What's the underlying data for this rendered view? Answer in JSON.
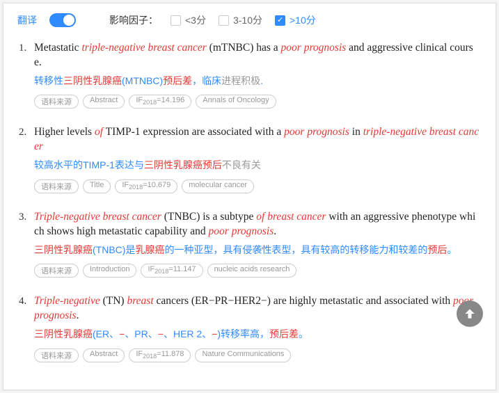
{
  "header": {
    "translate_label": "翻译",
    "factor_label": "影响因子：",
    "filters": [
      {
        "label": "<3分",
        "checked": false
      },
      {
        "label": "3-10分",
        "checked": false
      },
      {
        "label": ">10分",
        "checked": true
      }
    ]
  },
  "results": [
    {
      "num": "1.",
      "en_parts": [
        {
          "t": "Metastatic ",
          "h": false
        },
        {
          "t": "triple-negative breast cancer",
          "h": true
        },
        {
          "t": " (mTNBC) has a ",
          "h": false
        },
        {
          "t": "poor prognosis",
          "h": true
        },
        {
          "t": " and aggressive clinical course.",
          "h": false
        }
      ],
      "zh_parts": [
        {
          "t": "转移性",
          "c": "blue"
        },
        {
          "t": "三阴性乳腺癌",
          "c": "red"
        },
        {
          "t": "(MTNBC)",
          "c": "blue"
        },
        {
          "t": "预后差",
          "c": "red"
        },
        {
          "t": "，临床",
          "c": "blue"
        },
        {
          "t": "进程积极",
          "c": "gray"
        },
        {
          "t": ".",
          "c": "blue"
        }
      ],
      "tags": {
        "source": "语料来源",
        "section": "Abstract",
        "if_year": "2018",
        "if_val": "14.196",
        "journal": "Annals of Oncology"
      }
    },
    {
      "num": "2.",
      "en_parts": [
        {
          "t": "Higher levels ",
          "h": false
        },
        {
          "t": "of",
          "h": true
        },
        {
          "t": " TIMP-1 expression are associated with a ",
          "h": false
        },
        {
          "t": "poor prognosis",
          "h": true
        },
        {
          "t": " in ",
          "h": false
        },
        {
          "t": "triple-negative breast cancer",
          "h": true
        }
      ],
      "zh_parts": [
        {
          "t": "较高水平的TIMP-1表达与",
          "c": "blue"
        },
        {
          "t": "三阴性乳腺癌预后",
          "c": "red"
        },
        {
          "t": "不良有关",
          "c": "gray"
        }
      ],
      "tags": {
        "source": "语料来源",
        "section": "Title",
        "if_year": "2018",
        "if_val": "10.679",
        "journal": "molecular cancer"
      }
    },
    {
      "num": "3.",
      "en_parts": [
        {
          "t": "Triple-negative breast cancer",
          "h": true
        },
        {
          "t": " (TNBC) is a subtype ",
          "h": false
        },
        {
          "t": "of breast cancer",
          "h": true
        },
        {
          "t": " with an aggressive phenotype which shows high metastatic capability and ",
          "h": false
        },
        {
          "t": "poor prognosis",
          "h": true
        },
        {
          "t": ".",
          "h": false
        }
      ],
      "zh_parts": [
        {
          "t": "三阴性乳腺癌",
          "c": "red"
        },
        {
          "t": "(TNBC)是",
          "c": "blue"
        },
        {
          "t": "乳腺癌",
          "c": "red"
        },
        {
          "t": "的一种亚型，具有侵袭性表型，具有较高的转移能力和较差的",
          "c": "blue"
        },
        {
          "t": "预后",
          "c": "red"
        },
        {
          "t": "。",
          "c": "blue"
        }
      ],
      "tags": {
        "source": "语料来源",
        "section": "Introduction",
        "if_year": "2018",
        "if_val": "11.147",
        "journal": "nucleic acids research"
      }
    },
    {
      "num": "4.",
      "en_parts": [
        {
          "t": "Triple-negative",
          "h": true
        },
        {
          "t": " (TN) ",
          "h": false
        },
        {
          "t": "breast",
          "h": true
        },
        {
          "t": " cancers (ER−PR−HER2−) are highly metastatic and associated with ",
          "h": false
        },
        {
          "t": "poor prognosis",
          "h": true
        },
        {
          "t": ".",
          "h": false
        }
      ],
      "zh_parts": [
        {
          "t": "三阴性乳腺癌",
          "c": "red"
        },
        {
          "t": "(ER、",
          "c": "blue"
        },
        {
          "t": "−",
          "c": "red"
        },
        {
          "t": "、PR、",
          "c": "blue"
        },
        {
          "t": "−",
          "c": "red"
        },
        {
          "t": "、HER 2、",
          "c": "blue"
        },
        {
          "t": "−",
          "c": "red"
        },
        {
          "t": ")转移率高，",
          "c": "blue"
        },
        {
          "t": "预后差",
          "c": "red"
        },
        {
          "t": "。",
          "c": "blue"
        }
      ],
      "tags": {
        "source": "语料来源",
        "section": "Abstract",
        "if_year": "2018",
        "if_val": "11.878",
        "journal": "Nature Communications"
      }
    }
  ]
}
